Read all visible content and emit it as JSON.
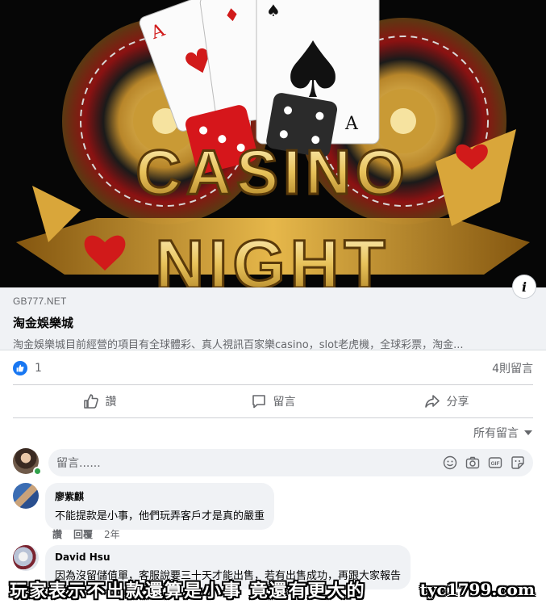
{
  "hero": {
    "banner_line1": "CASINO",
    "banner_line2": "NIGHT"
  },
  "link_preview": {
    "domain": "GB777.NET",
    "title": "淘金娛樂城",
    "description": "淘金娛樂城目前經營的項目有全球體彩、真人視訊百家樂casino，slot老虎機，全球彩票，淘金..."
  },
  "reactions": {
    "like_count": "1",
    "comment_count": "4則留言"
  },
  "actions": {
    "like_label": "讚",
    "comment_label": "留言",
    "share_label": "分享"
  },
  "sort": {
    "label": "所有留言"
  },
  "composer": {
    "placeholder": "留言......"
  },
  "comments": [
    {
      "author": "廖紫麒",
      "text": "不能提款是小事，他們玩弄客戶才是真的嚴重",
      "like_label": "讚",
      "reply_label": "回覆",
      "time": "2年"
    },
    {
      "author": "David Hsu",
      "text": "因為沒留儲值單，客服說要三十天才能出售，若有出售成功，再跟大家報告"
    }
  ],
  "caption": "玩家表示不出款還算是小事 竟還有更大的",
  "watermark": "tyc1799.com",
  "colors": {
    "facebook_blue": "#1877f2",
    "secondary_text": "#65676b",
    "bubble_bg": "#f0f2f5",
    "casino_gold": "#e8c25a"
  },
  "icons": [
    "info-icon",
    "like-icon",
    "comment-icon",
    "share-icon",
    "chevron-down-icon",
    "emoji-icon",
    "camera-icon",
    "gif-icon",
    "sticker-icon"
  ]
}
